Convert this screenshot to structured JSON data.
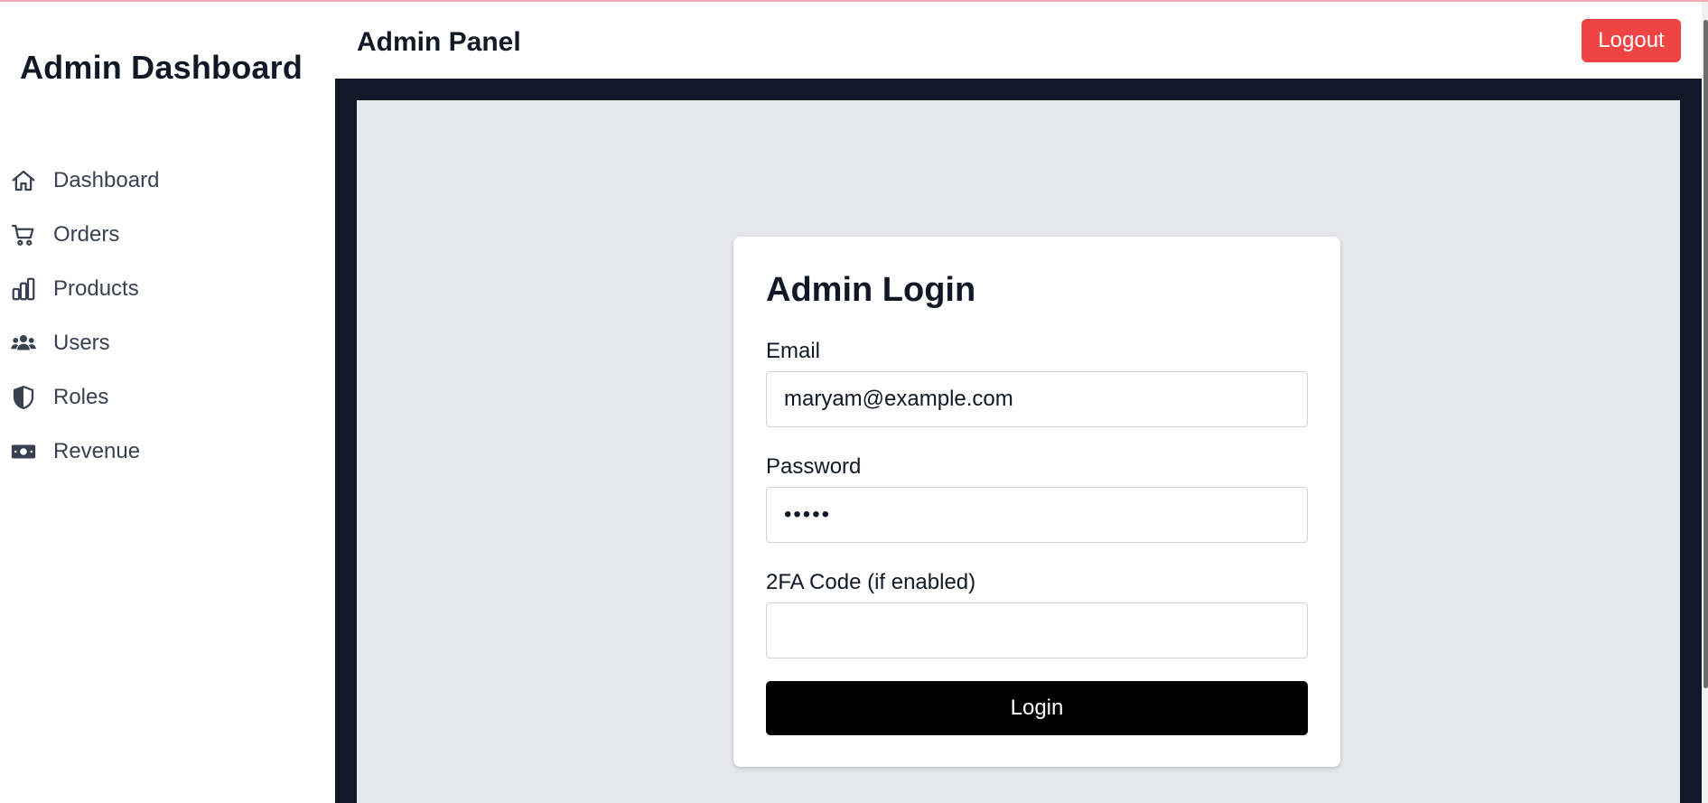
{
  "sidebar": {
    "brand": "Admin Dashboard",
    "items": [
      {
        "label": "Dashboard",
        "icon": "home-icon"
      },
      {
        "label": "Orders",
        "icon": "cart-icon"
      },
      {
        "label": "Products",
        "icon": "bar-chart-icon"
      },
      {
        "label": "Users",
        "icon": "users-icon"
      },
      {
        "label": "Roles",
        "icon": "shield-icon"
      },
      {
        "label": "Revenue",
        "icon": "money-icon"
      }
    ]
  },
  "header": {
    "title": "Admin Panel",
    "logout_label": "Logout"
  },
  "login": {
    "title": "Admin Login",
    "email_label": "Email",
    "email_value": "maryam@example.com",
    "password_label": "Password",
    "password_value": "•••••",
    "twofa_label": "2FA Code (if enabled)",
    "twofa_value": "",
    "submit_label": "Login"
  },
  "colors": {
    "logout": "#ef4444",
    "main_bg": "#111827",
    "content_bg": "#e5e7eb",
    "login_button": "#000000"
  }
}
